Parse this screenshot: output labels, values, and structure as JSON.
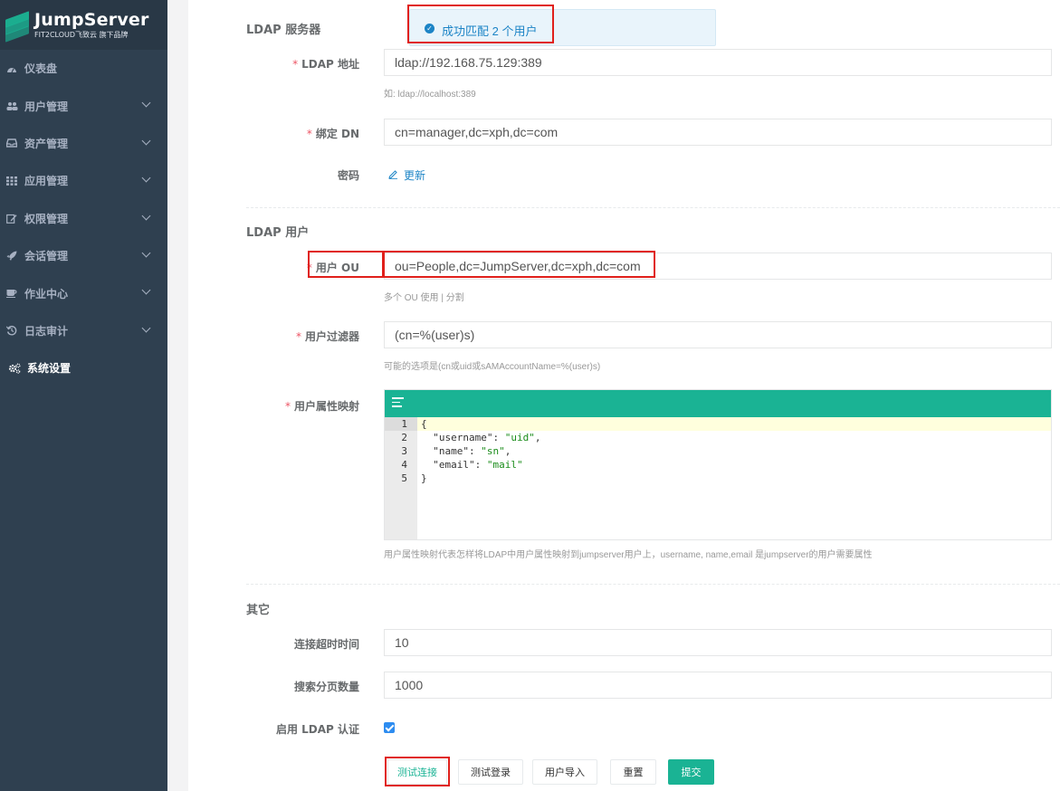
{
  "brand": {
    "title": "JumpServer",
    "subtitle": "FIT2CLOUD飞致云 旗下品牌"
  },
  "sidebar": {
    "items": [
      {
        "label": "仪表盘",
        "icon": "dashboard-icon"
      },
      {
        "label": "用户管理",
        "icon": "users-icon"
      },
      {
        "label": "资产管理",
        "icon": "inbox-icon"
      },
      {
        "label": "应用管理",
        "icon": "grid-icon"
      },
      {
        "label": "权限管理",
        "icon": "edit-icon"
      },
      {
        "label": "会话管理",
        "icon": "rocket-icon"
      },
      {
        "label": "作业中心",
        "icon": "coffee-icon"
      },
      {
        "label": "日志审计",
        "icon": "history-icon"
      },
      {
        "label": "系统设置",
        "icon": "gears-icon"
      }
    ]
  },
  "toast": {
    "message": "成功匹配 2 个用户"
  },
  "server_section": {
    "title": "LDAP 服务器",
    "ldap_address_label": "LDAP 地址",
    "ldap_address_value": "ldap://192.168.75.129:389",
    "ldap_address_help": "如: ldap://localhost:389",
    "bind_dn_label": "绑定 DN",
    "bind_dn_value": "cn=manager,dc=xph,dc=com",
    "password_label": "密码",
    "password_update_link": "更新"
  },
  "user_section": {
    "title": "LDAP 用户",
    "user_ou_label": "用户 OU",
    "user_ou_value": "ou=People,dc=JumpServer,dc=xph,dc=com",
    "user_ou_help": "多个 OU 使用 | 分割",
    "filter_label": "用户过滤器",
    "filter_value": "(cn=%(user)s)",
    "filter_help": "可能的选项是(cn或uid或sAMAccountName=%(user)s)",
    "attr_map_label": "用户属性映射",
    "attr_map_help": "用户属性映射代表怎样将LDAP中用户属性映射到jumpserver用户上，username, name,email 是jumpserver的用户需要属性",
    "code_lines": [
      {
        "num": "1",
        "key": "",
        "val": "",
        "raw": "{"
      },
      {
        "num": "2",
        "key": "\"username\"",
        "val": "\"uid\"",
        "raw": ""
      },
      {
        "num": "3",
        "key": "\"name\"",
        "val": "\"sn\"",
        "raw": ""
      },
      {
        "num": "4",
        "key": "\"email\"",
        "val": "\"mail\"",
        "raw": ""
      },
      {
        "num": "5",
        "key": "",
        "val": "",
        "raw": "}"
      }
    ]
  },
  "other_section": {
    "title": "其它",
    "timeout_label": "连接超时时间",
    "timeout_value": "10",
    "page_size_label": "搜索分页数量",
    "page_size_value": "1000",
    "enable_label": "启用 LDAP 认证",
    "enable_checked": true
  },
  "buttons": {
    "test_connection": "测试连接",
    "test_login": "测试登录",
    "user_import": "用户导入",
    "reset": "重置",
    "submit": "提交"
  },
  "colors": {
    "sidebar_bg": "#2f4050",
    "accent": "#1ab394",
    "link": "#1c84c6",
    "highlight_box": "#e0201b"
  }
}
